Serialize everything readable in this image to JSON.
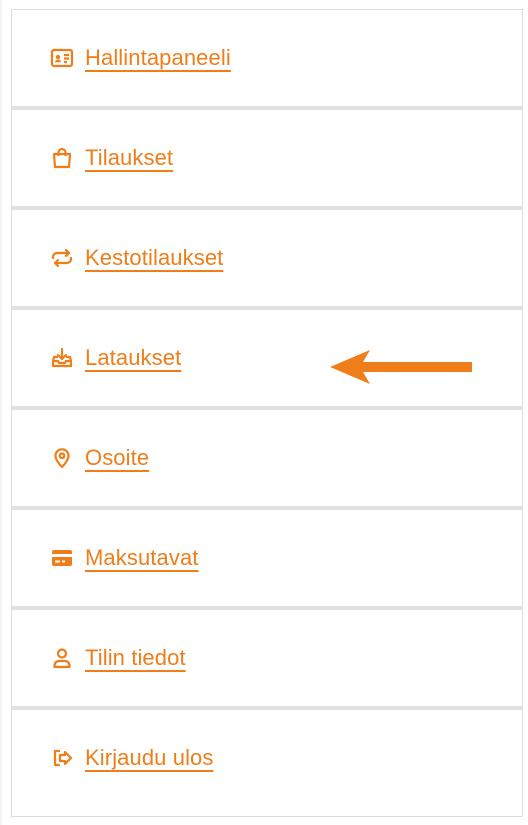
{
  "account_nav": {
    "items": [
      {
        "label": "Hallintapaneeli",
        "icon": "id-card-icon"
      },
      {
        "label": "Tilaukset",
        "icon": "shopping-bag-icon"
      },
      {
        "label": "Kestotilaukset",
        "icon": "repeat-icon"
      },
      {
        "label": "Lataukset",
        "icon": "download-icon"
      },
      {
        "label": "Osoite",
        "icon": "location-pin-icon"
      },
      {
        "label": "Maksutavat",
        "icon": "credit-card-icon"
      },
      {
        "label": "Tilin tiedot",
        "icon": "user-icon"
      },
      {
        "label": "Kirjaudu ulos",
        "icon": "logout-icon"
      }
    ]
  },
  "colors": {
    "accent": "#ef7d1a",
    "divider": "#e1e1e1",
    "border": "#dcdcdc"
  }
}
